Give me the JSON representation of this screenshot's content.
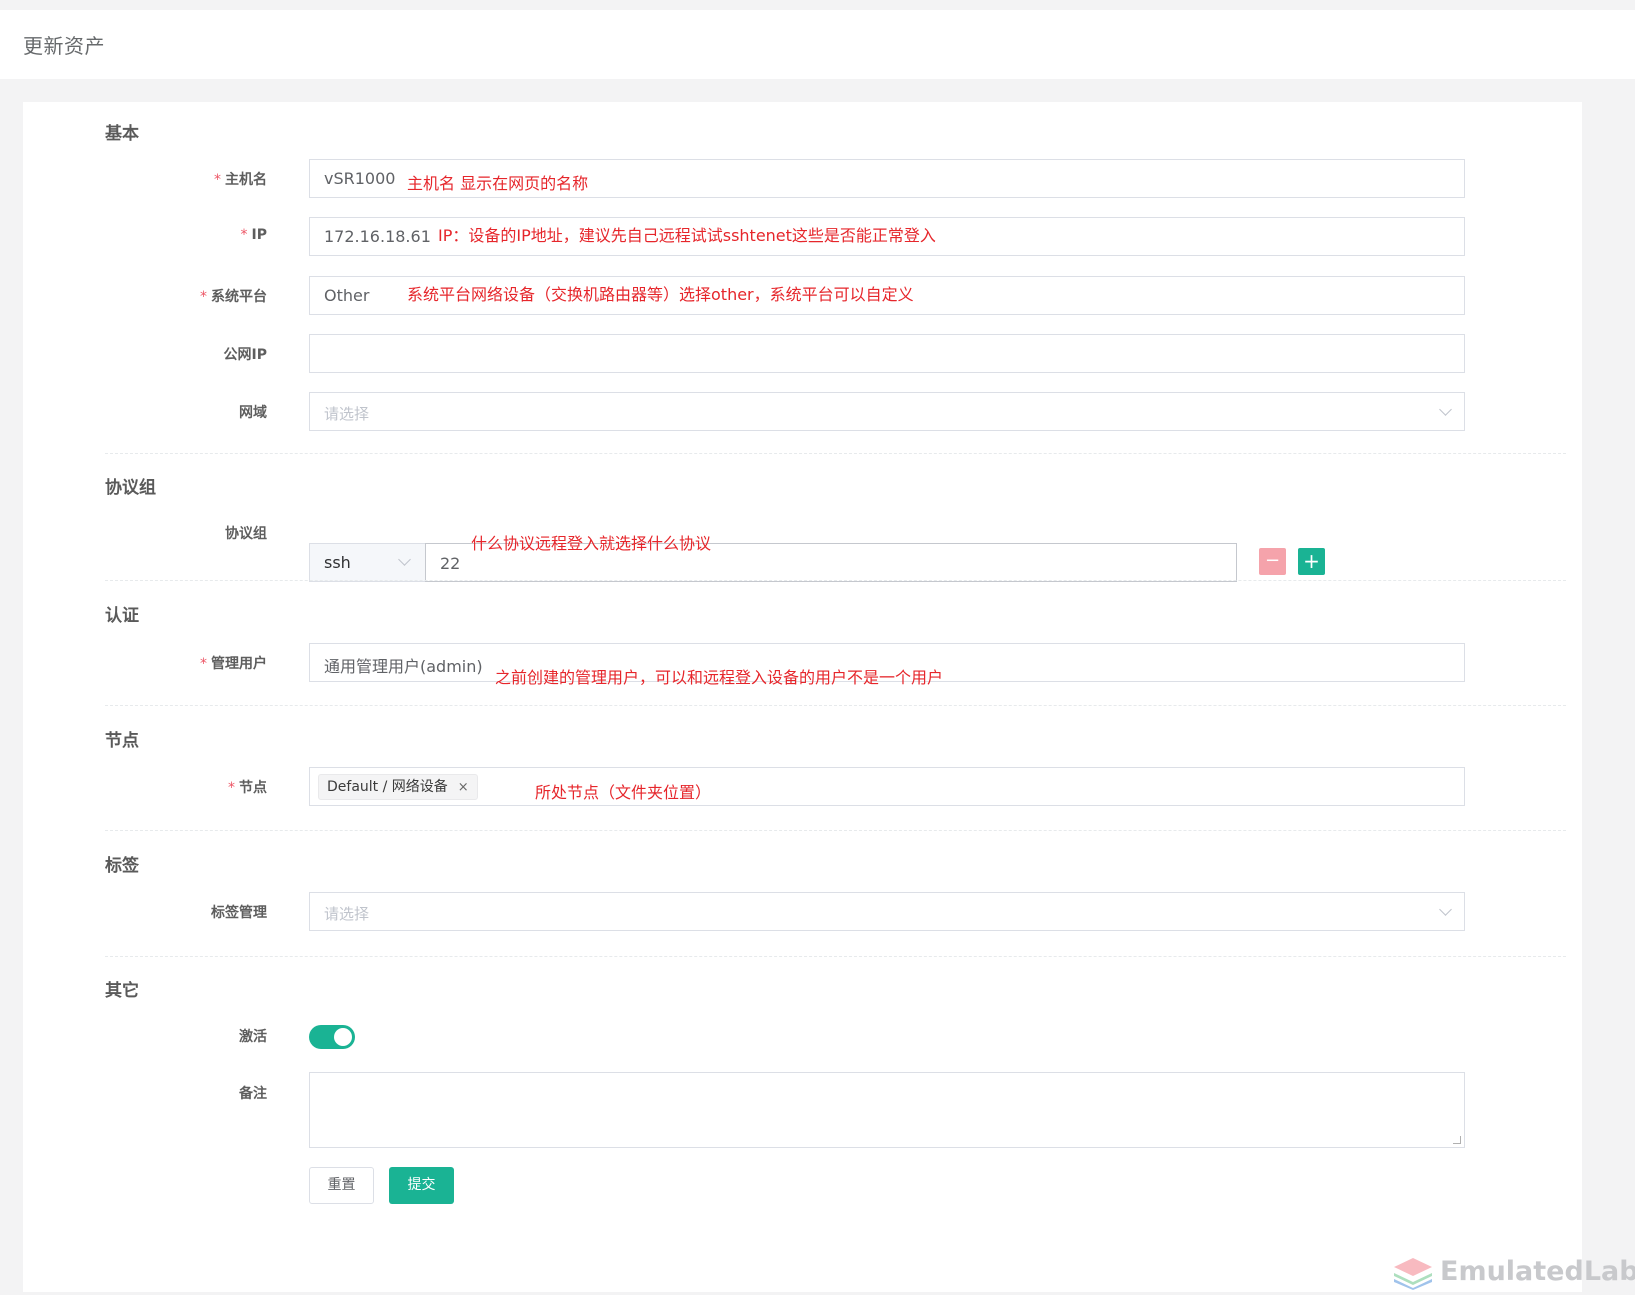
{
  "page": {
    "title": "更新资产"
  },
  "sections": {
    "basic": "基本",
    "protocols": "协议组",
    "auth": "认证",
    "nodes": "节点",
    "labels": "标签",
    "other": "其它"
  },
  "fields": {
    "hostname": {
      "label": "主机名",
      "value": "vSR1000",
      "required": "*"
    },
    "ip": {
      "label": "IP",
      "value": "172.16.18.61",
      "required": "*"
    },
    "platform": {
      "label": "系统平台",
      "value": "Other",
      "required": "*"
    },
    "public_ip": {
      "label": "公网IP",
      "value": ""
    },
    "domain": {
      "label": "网域",
      "placeholder": "请选择"
    },
    "protocols": {
      "label": "协议组",
      "protocol": "ssh",
      "port": "22",
      "minus": "−",
      "plus": "+"
    },
    "admin_user": {
      "label": "管理用户",
      "value": "通用管理用户(admin)",
      "required": "*"
    },
    "nodes": {
      "label": "节点",
      "tag": "Default / 网络设备",
      "tag_close": "×",
      "required": "*"
    },
    "labels": {
      "label": "标签管理",
      "placeholder": "请选择"
    },
    "active": {
      "label": "激活",
      "value": true
    },
    "comment": {
      "label": "备注",
      "value": ""
    }
  },
  "annotations": {
    "hostname": "主机名 显示在网页的名称",
    "ip": "IP：设备的IP地址，建议先自己远程试试sshtenet这些是否能正常登入",
    "platform": "系统平台网络设备（交换机路由器等）选择other，系统平台可以自定义",
    "protocols": "什么协议远程登入就选择什么协议",
    "admin_user": "之前创建的管理用户，可以和远程登入设备的用户不是一个用户",
    "nodes": "所处节点（文件夹位置）"
  },
  "buttons": {
    "reset": "重置",
    "submit": "提交"
  },
  "watermark": {
    "text": "EmulatedLab"
  },
  "colors": {
    "accent": "#1ab394",
    "danger_light": "#f5a3ab",
    "annotation": "#e6262b",
    "required": "#ed5565"
  }
}
